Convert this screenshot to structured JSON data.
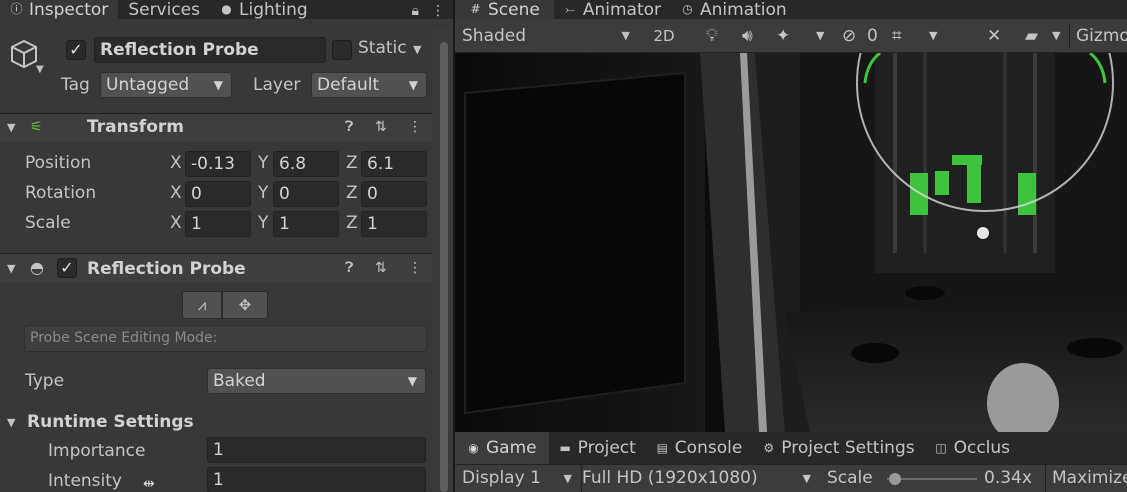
{
  "inspector": {
    "tabs": [
      {
        "label": "Inspector",
        "icon": "info-icon"
      },
      {
        "label": "Services",
        "icon": ""
      },
      {
        "label": "Lighting",
        "icon": "lightbulb-icon"
      }
    ],
    "object": {
      "name": "Reflection Probe",
      "active": true,
      "static_label": "Static",
      "tag_label": "Tag",
      "tag_value": "Untagged",
      "layer_label": "Layer",
      "layer_value": "Default"
    },
    "transform": {
      "title": "Transform",
      "rows": [
        {
          "label": "Position",
          "x": "-0.13",
          "y": "6.8",
          "z": "6.1"
        },
        {
          "label": "Rotation",
          "x": "0",
          "y": "0",
          "z": "0"
        },
        {
          "label": "Scale",
          "x": "1",
          "y": "1",
          "z": "1"
        }
      ],
      "axis_x": "X",
      "axis_y": "Y",
      "axis_z": "Z"
    },
    "reflection_probe": {
      "title": "Reflection Probe",
      "enabled": true,
      "editing_mode_placeholder": "Probe Scene Editing Mode:",
      "type_label": "Type",
      "type_value": "Baked",
      "runtime_settings_label": "Runtime Settings",
      "importance_label": "Importance",
      "importance_value": "1",
      "intensity_label": "Intensity",
      "intensity_value": "1"
    }
  },
  "scene": {
    "tabs": [
      {
        "label": "Scene",
        "icon": "scene-grid-icon"
      },
      {
        "label": "Animator",
        "icon": "animator-icon"
      },
      {
        "label": "Animation",
        "icon": "clock-icon"
      }
    ],
    "toolbar": {
      "shading_mode": "Shaded",
      "mode_2d": "2D",
      "hidden_count": "0",
      "gizmos_label": "Gizmo"
    }
  },
  "game": {
    "tabs": [
      {
        "label": "Game",
        "icon": "gamepad-icon"
      },
      {
        "label": "Project",
        "icon": "folder-icon"
      },
      {
        "label": "Console",
        "icon": "console-icon"
      },
      {
        "label": "Project Settings",
        "icon": "gear-icon"
      },
      {
        "label": "Occlus",
        "icon": "occlusion-icon"
      }
    ],
    "toolbar": {
      "display": "Display 1",
      "resolution": "Full HD (1920x1080)",
      "scale_label": "Scale",
      "scale_value": "0.34x",
      "maximize_label": "Maximize"
    }
  },
  "colors": {
    "panel_bg": "#383838",
    "tab_bg": "#282828",
    "green_accent": "#3ec33e"
  }
}
